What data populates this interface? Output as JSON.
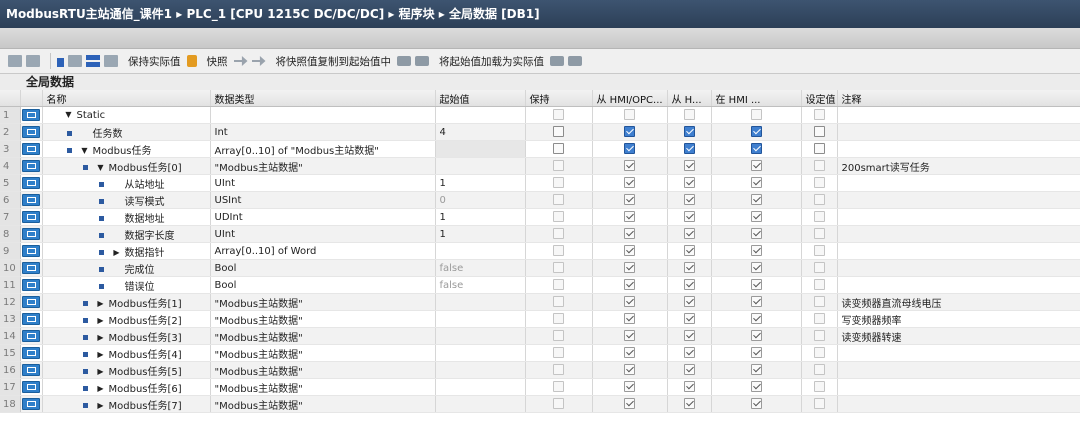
{
  "breadcrumb": {
    "project": "ModbusRTU主站通信_课件1",
    "device": "PLC_1 [CPU 1215C DC/DC/DC]",
    "folder": "程序块",
    "block": "全局数据 [DB1]",
    "separator": "▸"
  },
  "toolbar": {
    "keep_actual": "保持实际值",
    "snapshot": "快照",
    "copy_snapshot": "将快照值复制到起始值中",
    "load_start": "将起始值加载为实际值"
  },
  "block_title": "全局数据",
  "columns": [
    "名称",
    "数据类型",
    "起始值",
    "保持",
    "从 HMI/OPC...",
    "从 H...",
    "在 HMI ...",
    "设定值",
    "注释"
  ],
  "rows": [
    {
      "num": "1",
      "indent": 0,
      "marker": false,
      "toggle": "▼",
      "name": "Static",
      "type": "",
      "start": "",
      "shade": false,
      "retain": "dim",
      "hmi_opc": "dim",
      "h": "dim",
      "in_hmi": "dim",
      "setpoint": "dim",
      "comment": ""
    },
    {
      "num": "2",
      "indent": 1,
      "marker": true,
      "toggle": "",
      "name": "任务数",
      "type": "Int",
      "start": "4",
      "shade": false,
      "retain": "off",
      "hmi_opc": "on",
      "h": "on",
      "in_hmi": "on",
      "setpoint": "off",
      "comment": ""
    },
    {
      "num": "3",
      "indent": 1,
      "marker": true,
      "toggle": "▼",
      "name": "Modbus任务",
      "type": "Array[0..10] of \"Modbus主站数据\"",
      "start": "",
      "shade": true,
      "retain": "off",
      "hmi_opc": "on",
      "h": "on",
      "in_hmi": "on",
      "setpoint": "off",
      "comment": ""
    },
    {
      "num": "4",
      "indent": 2,
      "marker": true,
      "toggle": "▼",
      "name": "Modbus任务[0]",
      "type": "\"Modbus主站数据\"",
      "start": "",
      "shade": false,
      "retain": "dim",
      "hmi_opc": "gray",
      "h": "gray",
      "in_hmi": "gray",
      "setpoint": "dim",
      "comment": "200smart读写任务"
    },
    {
      "num": "5",
      "indent": 3,
      "marker": true,
      "toggle": "",
      "name": "从站地址",
      "type": "UInt",
      "start": "1",
      "shade": false,
      "retain": "dim",
      "hmi_opc": "gray",
      "h": "gray",
      "in_hmi": "gray",
      "setpoint": "dim",
      "comment": ""
    },
    {
      "num": "6",
      "indent": 3,
      "marker": true,
      "toggle": "",
      "name": "读写模式",
      "type": "USInt",
      "start": "0",
      "grey": true,
      "shade": false,
      "retain": "dim",
      "hmi_opc": "gray",
      "h": "gray",
      "in_hmi": "gray",
      "setpoint": "dim",
      "comment": ""
    },
    {
      "num": "7",
      "indent": 3,
      "marker": true,
      "toggle": "",
      "name": "数据地址",
      "type": "UDInt",
      "start": "1",
      "shade": false,
      "retain": "dim",
      "hmi_opc": "gray",
      "h": "gray",
      "in_hmi": "gray",
      "setpoint": "dim",
      "comment": ""
    },
    {
      "num": "8",
      "indent": 3,
      "marker": true,
      "toggle": "",
      "name": "数据字长度",
      "type": "UInt",
      "start": "1",
      "shade": false,
      "retain": "dim",
      "hmi_opc": "gray",
      "h": "gray",
      "in_hmi": "gray",
      "setpoint": "dim",
      "comment": ""
    },
    {
      "num": "9",
      "indent": 3,
      "marker": true,
      "toggle": "▶",
      "name": "数据指针",
      "type": "Array[0..10] of Word",
      "start": "",
      "shade": false,
      "retain": "dim",
      "hmi_opc": "gray",
      "h": "gray",
      "in_hmi": "gray",
      "setpoint": "dim",
      "comment": ""
    },
    {
      "num": "10",
      "indent": 3,
      "marker": true,
      "toggle": "",
      "name": "完成位",
      "type": "Bool",
      "start": "false",
      "grey": true,
      "shade": false,
      "retain": "dim",
      "hmi_opc": "gray",
      "h": "gray",
      "in_hmi": "gray",
      "setpoint": "dim",
      "comment": ""
    },
    {
      "num": "11",
      "indent": 3,
      "marker": true,
      "toggle": "",
      "name": "错误位",
      "type": "Bool",
      "start": "false",
      "grey": true,
      "shade": false,
      "retain": "dim",
      "hmi_opc": "gray",
      "h": "gray",
      "in_hmi": "gray",
      "setpoint": "dim",
      "comment": ""
    },
    {
      "num": "12",
      "indent": 2,
      "marker": true,
      "toggle": "▶",
      "name": "Modbus任务[1]",
      "type": "\"Modbus主站数据\"",
      "start": "",
      "shade": false,
      "retain": "dim",
      "hmi_opc": "gray",
      "h": "gray",
      "in_hmi": "gray",
      "setpoint": "dim",
      "comment": "读变频器直流母线电压"
    },
    {
      "num": "13",
      "indent": 2,
      "marker": true,
      "toggle": "▶",
      "name": "Modbus任务[2]",
      "type": "\"Modbus主站数据\"",
      "start": "",
      "shade": false,
      "retain": "dim",
      "hmi_opc": "gray",
      "h": "gray",
      "in_hmi": "gray",
      "setpoint": "dim",
      "comment": "写变频器频率"
    },
    {
      "num": "14",
      "indent": 2,
      "marker": true,
      "toggle": "▶",
      "name": "Modbus任务[3]",
      "type": "\"Modbus主站数据\"",
      "start": "",
      "shade": false,
      "retain": "dim",
      "hmi_opc": "gray",
      "h": "gray",
      "in_hmi": "gray",
      "setpoint": "dim",
      "comment": "读变频器转速"
    },
    {
      "num": "15",
      "indent": 2,
      "marker": true,
      "toggle": "▶",
      "name": "Modbus任务[4]",
      "type": "\"Modbus主站数据\"",
      "start": "",
      "shade": false,
      "retain": "dim",
      "hmi_opc": "gray",
      "h": "gray",
      "in_hmi": "gray",
      "setpoint": "dim",
      "comment": ""
    },
    {
      "num": "16",
      "indent": 2,
      "marker": true,
      "toggle": "▶",
      "name": "Modbus任务[5]",
      "type": "\"Modbus主站数据\"",
      "start": "",
      "shade": false,
      "retain": "dim",
      "hmi_opc": "gray",
      "h": "gray",
      "in_hmi": "gray",
      "setpoint": "dim",
      "comment": ""
    },
    {
      "num": "17",
      "indent": 2,
      "marker": true,
      "toggle": "▶",
      "name": "Modbus任务[6]",
      "type": "\"Modbus主站数据\"",
      "start": "",
      "shade": false,
      "retain": "dim",
      "hmi_opc": "gray",
      "h": "gray",
      "in_hmi": "gray",
      "setpoint": "dim",
      "comment": ""
    },
    {
      "num": "18",
      "indent": 2,
      "marker": true,
      "toggle": "▶",
      "name": "Modbus任务[7]",
      "type": "\"Modbus主站数据\"",
      "start": "",
      "shade": false,
      "retain": "dim",
      "hmi_opc": "gray",
      "h": "gray",
      "in_hmi": "gray",
      "setpoint": "dim",
      "comment": ""
    }
  ]
}
